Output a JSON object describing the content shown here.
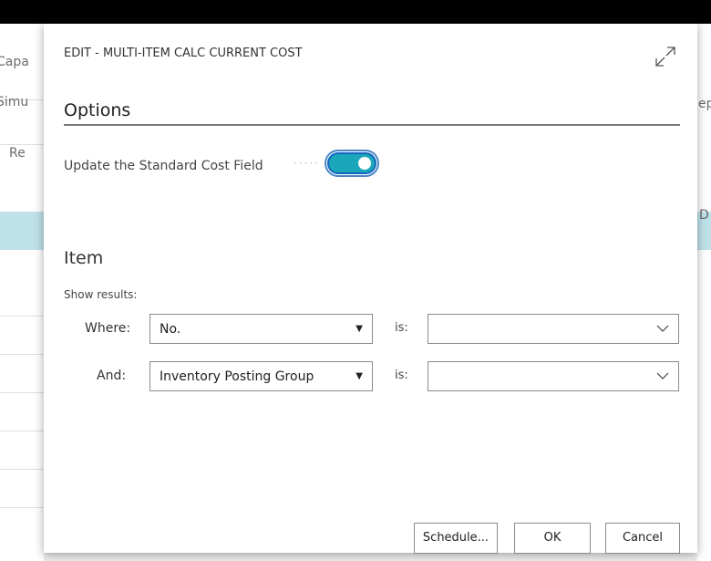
{
  "background": {
    "left_texts": [
      "Capa",
      "Simu",
      "Re"
    ],
    "right_texts": [
      "ep",
      "D"
    ]
  },
  "dialog": {
    "title": "EDIT - MULTI-ITEM CALC CURRENT COST",
    "expand_icon": "expand-icon",
    "options": {
      "title": "Options",
      "update_standard_cost_label": "Update the Standard Cost Field",
      "update_standard_cost_value": true
    },
    "item": {
      "title": "Item",
      "show_results_label": "Show results:",
      "filters": [
        {
          "label": "Where:",
          "field": "No.",
          "is_label": "is:",
          "value": ""
        },
        {
          "label": "And:",
          "field": "Inventory Posting Group",
          "is_label": "is:",
          "value": ""
        }
      ]
    },
    "buttons": {
      "schedule": "Schedule...",
      "ok": "OK",
      "cancel": "Cancel"
    }
  },
  "colors": {
    "toggle_on": "#1aa7b9",
    "highlight_row": "#bfe2ea",
    "overlay": "#000000"
  }
}
